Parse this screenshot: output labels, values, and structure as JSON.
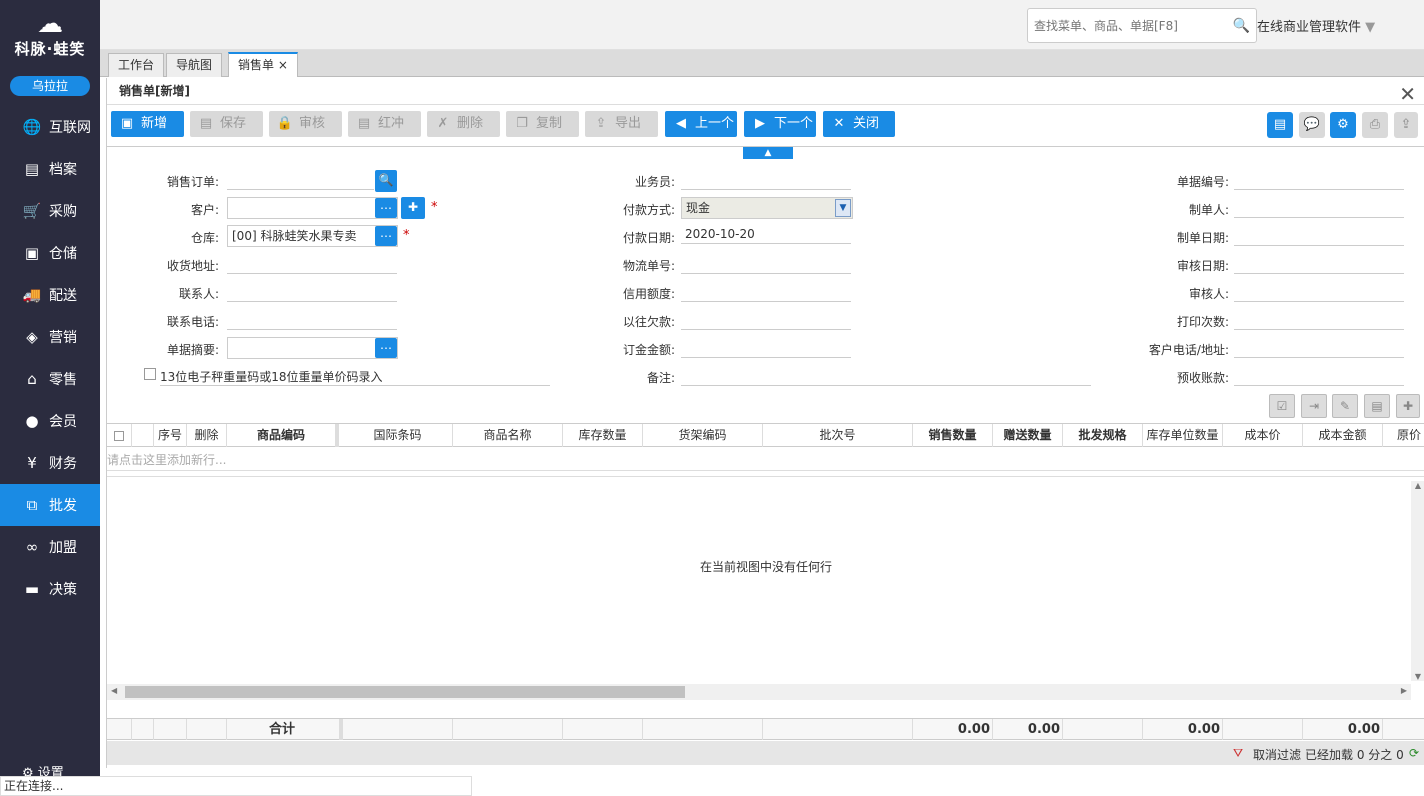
{
  "sidebar": {
    "brand": "科脉·蛙笑",
    "user": "乌拉拉",
    "items": [
      {
        "label": "互联网",
        "icon": "globe-icon",
        "glyph": "🌐"
      },
      {
        "label": "档案",
        "icon": "archive-icon",
        "glyph": "▤"
      },
      {
        "label": "采购",
        "icon": "cart-icon",
        "glyph": "🛒"
      },
      {
        "label": "仓储",
        "icon": "box-icon",
        "glyph": "▣"
      },
      {
        "label": "配送",
        "icon": "truck-icon",
        "glyph": "🚚"
      },
      {
        "label": "营销",
        "icon": "tag-icon",
        "glyph": "◈"
      },
      {
        "label": "零售",
        "icon": "basket-icon",
        "glyph": "⌂"
      },
      {
        "label": "会员",
        "icon": "user-icon",
        "glyph": "●"
      },
      {
        "label": "财务",
        "icon": "yen-icon",
        "glyph": "¥"
      },
      {
        "label": "批发",
        "icon": "wholesale-icon",
        "glyph": "⧉",
        "active": true
      },
      {
        "label": "加盟",
        "icon": "rings-icon",
        "glyph": "∞"
      },
      {
        "label": "决策",
        "icon": "briefcase-icon",
        "glyph": "▬"
      }
    ],
    "settings": "设置"
  },
  "topbar": {
    "search_placeholder": "查找菜单、商品、单据[F8]",
    "app_title": "在线商业管理软件"
  },
  "tabs": [
    {
      "label": "工作台"
    },
    {
      "label": "导航图"
    },
    {
      "label": "销售单",
      "close": "×"
    }
  ],
  "panel": {
    "title": "销售单[新增]",
    "close": "✕"
  },
  "toolbar": {
    "new": "新增",
    "save": "保存",
    "audit": "审核",
    "red": "红冲",
    "delete": "删除",
    "copy": "复制",
    "export": "导出",
    "prev": "上一个",
    "next": "下一个",
    "close": "关闭"
  },
  "form": {
    "sales_order_label": "销售订单:",
    "customer_label": "客户:",
    "warehouse_label": "仓库:",
    "warehouse_value": "[00] 科脉蛙笑水果专卖",
    "address_label": "收货地址:",
    "contact_label": "联系人:",
    "phone_label": "联系电话:",
    "summary_label": "单据摘要:",
    "scale_checkbox": "13位电子秤重量码或18位重量单价码录入",
    "salesman_label": "业务员:",
    "pay_method_label": "付款方式:",
    "pay_method_value": "现金",
    "pay_date_label": "付款日期:",
    "pay_date_value": "2020-10-20",
    "logistics_label": "物流单号:",
    "credit_label": "信用额度:",
    "prev_debt_label": "以往欠款:",
    "deposit_label": "订金金额:",
    "remark_label": "备注:",
    "doc_no_label": "单据编号:",
    "maker_label": "制单人:",
    "make_date_label": "制单日期:",
    "audit_date_label": "审核日期:",
    "auditor_label": "审核人:",
    "print_count_label": "打印次数:",
    "cust_phone_label": "客户电话/地址:",
    "prepaid_label": "预收账款:"
  },
  "grid": {
    "columns": [
      "序号",
      "删除",
      "商品编码",
      "国际条码",
      "商品名称",
      "库存数量",
      "货架编码",
      "批次号",
      "销售数量",
      "赠送数量",
      "批发规格",
      "库存单位数量",
      "成本价",
      "成本金额",
      "原价"
    ],
    "add_row_hint": "请点击这里添加新行...",
    "empty_text": "在当前视图中没有任何行",
    "total_label": "合计",
    "totals": [
      "0.00",
      "0.00",
      "0.00",
      "0.00"
    ]
  },
  "status": {
    "cancel_filter": "取消过滤",
    "loaded": "已经加载 0 分之 0"
  },
  "connection": "正在连接..."
}
